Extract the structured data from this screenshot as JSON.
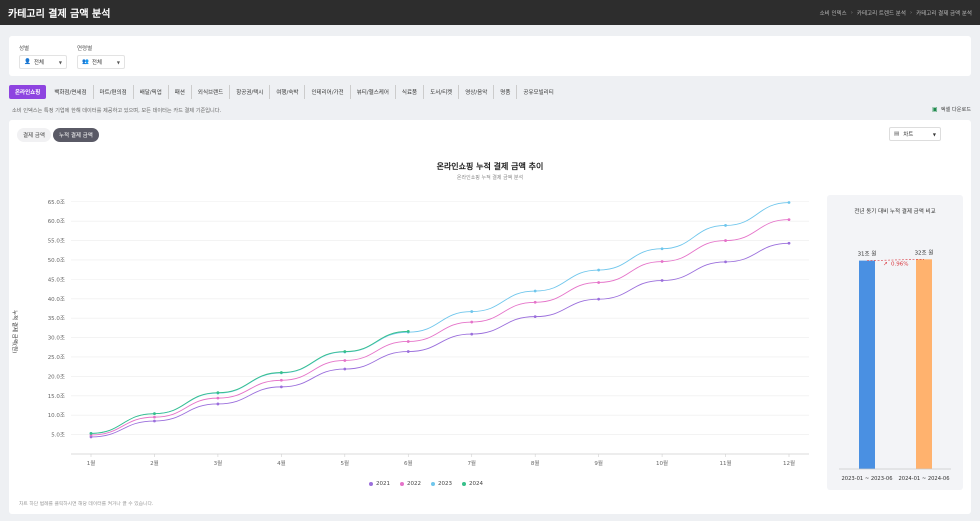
{
  "header": {
    "title": "카테고리 결제 금액 분석",
    "breadcrumbs": [
      "소비 인덱스",
      "카테고리 트렌드 분석",
      "카테고리 결제 금액 분석"
    ]
  },
  "filters": {
    "gender": {
      "label": "성별",
      "value": "전체",
      "icon": "person-icon"
    },
    "age": {
      "label": "연령별",
      "value": "전체",
      "icon": "group-icon"
    }
  },
  "tabs": [
    "온라인쇼핑",
    "백화점/면세점",
    "마트/편의점",
    "배달/픽업",
    "패션",
    "외식브랜드",
    "항공권/택시",
    "여행/숙박",
    "인테리어/가전",
    "뷰티/헬스케어",
    "식료품",
    "도서/티켓",
    "영상/음악",
    "명품",
    "공유모빌리티"
  ],
  "active_tab": 0,
  "notice": "소비 인덱스는 특정 기업에 한해 데이터를 제공하고 있으며, 모든 데이터는 카드 결제 기준입니다.",
  "excel_download": "엑셀 다운로드",
  "segment": [
    "결제 금액",
    "누적 결제 금액"
  ],
  "active_segment": 1,
  "chart_select": "차트",
  "footnote": "차트 하단 범례를 클릭하시면 해당 데이터를 켜거나 끌 수 있습니다.",
  "colors": {
    "accent": "#8e44e0",
    "s2021": "#9b6fdc",
    "s2022": "#e573c9",
    "s2023": "#6fc6ec",
    "s2024": "#37c08a",
    "bar1": "#4a90e2",
    "bar2": "#ffb26e",
    "delta": "#d9363e"
  },
  "chart_data": [
    {
      "type": "line",
      "title": "온라인쇼핑 누적 결제 금액 추이",
      "subtitle": "온라인쇼핑 누적 결제 금액 분석",
      "xlabel": "",
      "ylabel": "누적 결제 금액(원)",
      "categories": [
        "1월",
        "2월",
        "3월",
        "4월",
        "5월",
        "6월",
        "7월",
        "8월",
        "9월",
        "10월",
        "11월",
        "12월"
      ],
      "yticks": [
        "5.0조",
        "10.0조",
        "15.0조",
        "20.0조",
        "25.0조",
        "30.0조",
        "35.0조",
        "40.0조",
        "45.0조",
        "50.0조",
        "55.0조",
        "60.0조",
        "65.0조"
      ],
      "ylim": [
        0,
        67
      ],
      "unit": "조",
      "series": [
        {
          "name": "2021",
          "color": "#9b6fdc",
          "values": [
            4.4,
            8.5,
            12.9,
            17.3,
            21.9,
            26.4,
            30.9,
            35.4,
            39.9,
            44.7,
            49.5,
            54.3
          ]
        },
        {
          "name": "2022",
          "color": "#e573c9",
          "values": [
            4.9,
            9.5,
            14.4,
            19.0,
            24.1,
            29.0,
            34.0,
            39.1,
            44.2,
            49.6,
            55.0,
            60.4
          ]
        },
        {
          "name": "2023",
          "color": "#6fc6ec",
          "values": [
            5.3,
            10.4,
            15.7,
            20.9,
            26.3,
            31.4,
            36.7,
            42.0,
            47.4,
            52.9,
            58.9,
            64.8
          ]
        },
        {
          "name": "2024",
          "color": "#37c08a",
          "values": [
            5.3,
            10.4,
            15.8,
            21.0,
            26.4,
            31.6
          ]
        }
      ],
      "grid": true,
      "legend": "bottom"
    },
    {
      "type": "bar",
      "title": "전년 동기 대비 누적 결제 금액 비교",
      "categories": [
        "2023-01 ~ 2023-06",
        "2024-01 ~ 2024-06"
      ],
      "values": [
        31.4,
        31.6
      ],
      "value_labels": [
        "31조 원",
        "32조 원"
      ],
      "change_label": "0.96%",
      "colors": [
        "#4a90e2",
        "#ffb26e"
      ]
    }
  ]
}
